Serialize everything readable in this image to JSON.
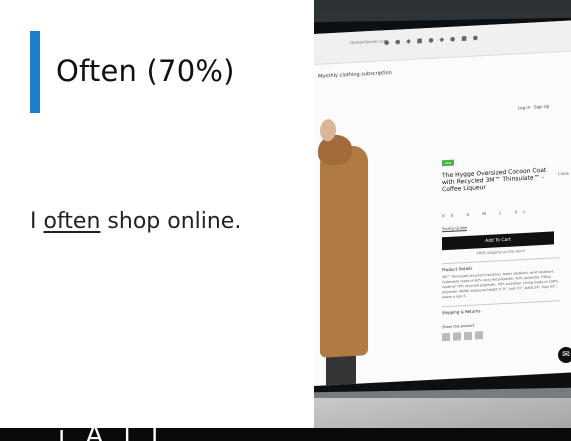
{
  "slide": {
    "title": "Often (70%)",
    "sentence_prefix": "I ",
    "sentence_keyword": "often",
    "sentence_suffix": " shop online.",
    "accent_color": "#1a7fd0"
  },
  "website": {
    "url": "thehardlyever.com",
    "banner": "Monthly clothing subscription",
    "auth_links": "Log In · Sign Up",
    "product": {
      "badge": "new",
      "title": "The Hygge Oversized Cocoon Coat with Recycled 3M™ Thinsulate™ - Coffee Liqueur",
      "sizes": "XS S M L XL",
      "sizing_guide": "Sizing Guide",
      "add_to_cart": "Add To Cart",
      "free_shipping": "FREE shipping on this item!",
      "details_label": "Product Details",
      "details_text": "3M™ Thinsulate recycled insulation, water repellent, wind resistant. Outershell made of 67% recycled polyester, 40% polyester. Filling made of 70% recycled polyester, 30% polyester. Lining made of 100% polyester. Model measures height 5' 9\", bust 31\", waist 24\", hips 35\", wears a size S.",
      "shipping_label": "Shipping & Returns",
      "share_label": "Share this product",
      "close_label": "Close"
    }
  },
  "caption": {
    "text": "i   A   l   l"
  }
}
